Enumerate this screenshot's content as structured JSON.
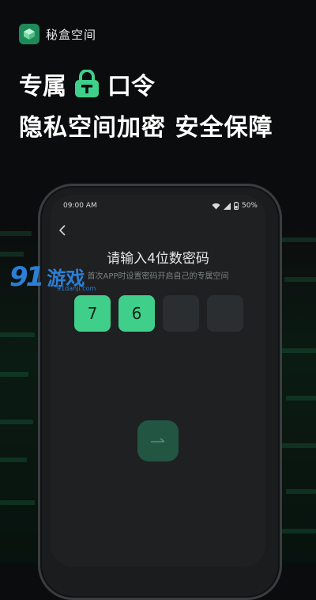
{
  "brand": {
    "name": "秘盒空间"
  },
  "headline": {
    "line1_left": "专属",
    "line1_right": "口令",
    "line2": "隐私空间加密 安全保障"
  },
  "status_bar": {
    "time": "09:00 AM",
    "battery": "50%"
  },
  "pin_screen": {
    "title": "请输入4位数密码",
    "subtitle": "首次APP时设置密码开启自己的专属空间",
    "digits": [
      "7",
      "6",
      "",
      ""
    ]
  },
  "watermark": {
    "logo": "91",
    "text": "游戏",
    "url": "91danji.com"
  },
  "colors": {
    "accent": "#3fcf8b",
    "brand_icon": "#1f8a58",
    "watermark": "#2b7fd6"
  },
  "icons": {
    "back": "chevron-left-icon",
    "next": "arrow-right-icon",
    "lock": "lock-icon"
  }
}
